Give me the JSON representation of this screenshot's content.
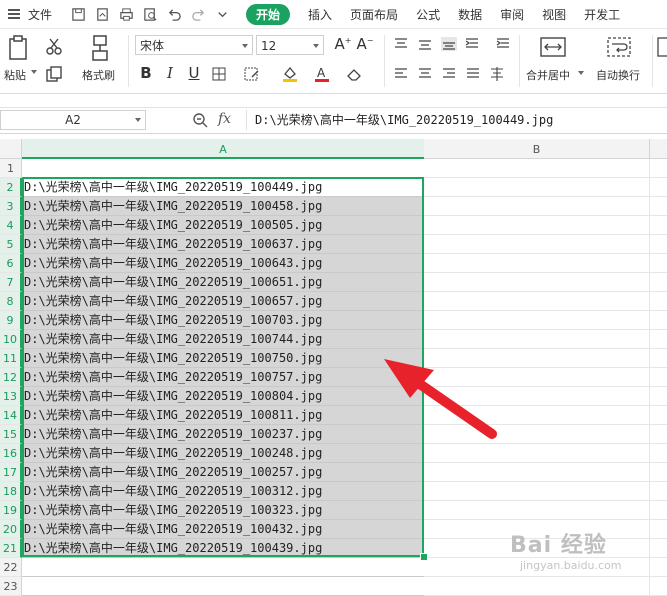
{
  "menu": {
    "file_label": "文件",
    "tabs": [
      "开始",
      "插入",
      "页面布局",
      "公式",
      "数据",
      "审阅",
      "视图",
      "开发工"
    ],
    "active_tab_index": 0,
    "accent_color": "#1ba260"
  },
  "ribbon": {
    "paste_label": "粘贴",
    "format_painter_label": "格式刷",
    "font_name": "宋体",
    "font_size": "12",
    "merge_label": "合并居中",
    "wrap_label": "自动换行"
  },
  "formula_bar": {
    "name_box": "A2",
    "fx_label": "fx",
    "content": "D:\\光荣榜\\高中一年级\\IMG_20220519_100449.jpg"
  },
  "sheet": {
    "col_headers": [
      "A",
      "B"
    ],
    "selection_color": "#1ea560",
    "rows": [
      {
        "num": "1",
        "a": ""
      },
      {
        "num": "2",
        "a": "D:\\光荣榜\\高中一年级\\IMG_20220519_100449.jpg"
      },
      {
        "num": "3",
        "a": "D:\\光荣榜\\高中一年级\\IMG_20220519_100458.jpg"
      },
      {
        "num": "4",
        "a": "D:\\光荣榜\\高中一年级\\IMG_20220519_100505.jpg"
      },
      {
        "num": "5",
        "a": "D:\\光荣榜\\高中一年级\\IMG_20220519_100637.jpg"
      },
      {
        "num": "6",
        "a": "D:\\光荣榜\\高中一年级\\IMG_20220519_100643.jpg"
      },
      {
        "num": "7",
        "a": "D:\\光荣榜\\高中一年级\\IMG_20220519_100651.jpg"
      },
      {
        "num": "8",
        "a": "D:\\光荣榜\\高中一年级\\IMG_20220519_100657.jpg"
      },
      {
        "num": "9",
        "a": "D:\\光荣榜\\高中一年级\\IMG_20220519_100703.jpg"
      },
      {
        "num": "10",
        "a": "D:\\光荣榜\\高中一年级\\IMG_20220519_100744.jpg"
      },
      {
        "num": "11",
        "a": "D:\\光荣榜\\高中一年级\\IMG_20220519_100750.jpg"
      },
      {
        "num": "12",
        "a": "D:\\光荣榜\\高中一年级\\IMG_20220519_100757.jpg"
      },
      {
        "num": "13",
        "a": "D:\\光荣榜\\高中一年级\\IMG_20220519_100804.jpg"
      },
      {
        "num": "14",
        "a": "D:\\光荣榜\\高中一年级\\IMG_20220519_100811.jpg"
      },
      {
        "num": "15",
        "a": "D:\\光荣榜\\高中一年级\\IMG_20220519_100237.jpg"
      },
      {
        "num": "16",
        "a": "D:\\光荣榜\\高中一年级\\IMG_20220519_100248.jpg"
      },
      {
        "num": "17",
        "a": "D:\\光荣榜\\高中一年级\\IMG_20220519_100257.jpg"
      },
      {
        "num": "18",
        "a": "D:\\光荣榜\\高中一年级\\IMG_20220519_100312.jpg"
      },
      {
        "num": "19",
        "a": "D:\\光荣榜\\高中一年级\\IMG_20220519_100323.jpg"
      },
      {
        "num": "20",
        "a": "D:\\光荣榜\\高中一年级\\IMG_20220519_100432.jpg"
      },
      {
        "num": "21",
        "a": "D:\\光荣榜\\高中一年级\\IMG_20220519_100439.jpg"
      },
      {
        "num": "22",
        "a": ""
      },
      {
        "num": "23",
        "a": ""
      }
    ]
  },
  "watermark": {
    "text": "Bai 经验",
    "sub": "jingyan.baidu.com"
  },
  "annotation_arrow_color": "#e8222a"
}
